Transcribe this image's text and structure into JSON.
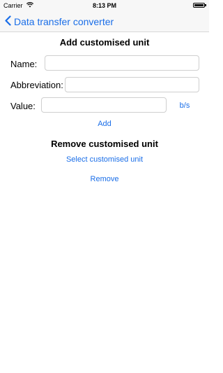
{
  "status_bar": {
    "carrier": "Carrier",
    "time": "8:13 PM"
  },
  "nav": {
    "back_label": "Data transfer converter"
  },
  "add_section": {
    "title": "Add customised unit",
    "name_label": "Name:",
    "name_value": "",
    "abbreviation_label": "Abbreviation:",
    "abbreviation_value": "",
    "value_label": "Value:",
    "value_value": "",
    "unit_label": "b/s",
    "add_label": "Add"
  },
  "remove_section": {
    "title": "Remove customised unit",
    "select_label": "Select customised unit",
    "remove_label": "Remove"
  },
  "colors": {
    "accent": "#1a6ee8"
  }
}
